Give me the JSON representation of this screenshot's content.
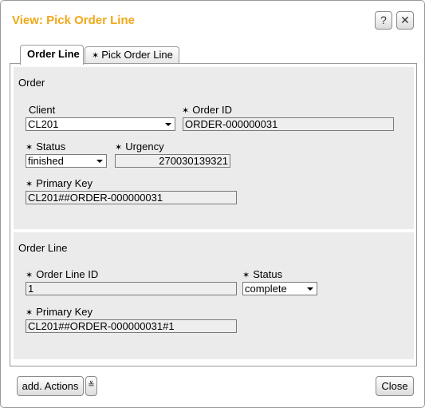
{
  "window": {
    "title": "View: Pick Order Line",
    "help_icon": "?",
    "close_icon": "✕"
  },
  "tabs": [
    {
      "label": "Order Line",
      "active": true
    },
    {
      "label": "Pick Order Line",
      "active": false,
      "marker": "✶"
    }
  ],
  "required_marker": "✶",
  "order": {
    "title": "Order",
    "client_label": "Client",
    "client_value": "CL201",
    "order_id_label": "Order ID",
    "order_id_value": "ORDER-000000031",
    "status_label": "Status",
    "status_value": "finished",
    "urgency_label": "Urgency",
    "urgency_value": "270030139321",
    "primary_key_label": "Primary Key",
    "primary_key_value": "CL201##ORDER-000000031"
  },
  "order_line": {
    "title": "Order Line",
    "line_id_label": "Order Line ID",
    "line_id_value": "1",
    "status_label": "Status",
    "status_value": "complete",
    "primary_key_label": "Primary Key",
    "primary_key_value": "CL201##ORDER-000000031#1"
  },
  "footer": {
    "add_actions_label": "add. Actions",
    "more_icon": "≚",
    "close_label": "Close"
  },
  "colors": {
    "title": "#f0a818",
    "panel_bg": "#ebebeb",
    "field_bg": "#eeeeee"
  }
}
